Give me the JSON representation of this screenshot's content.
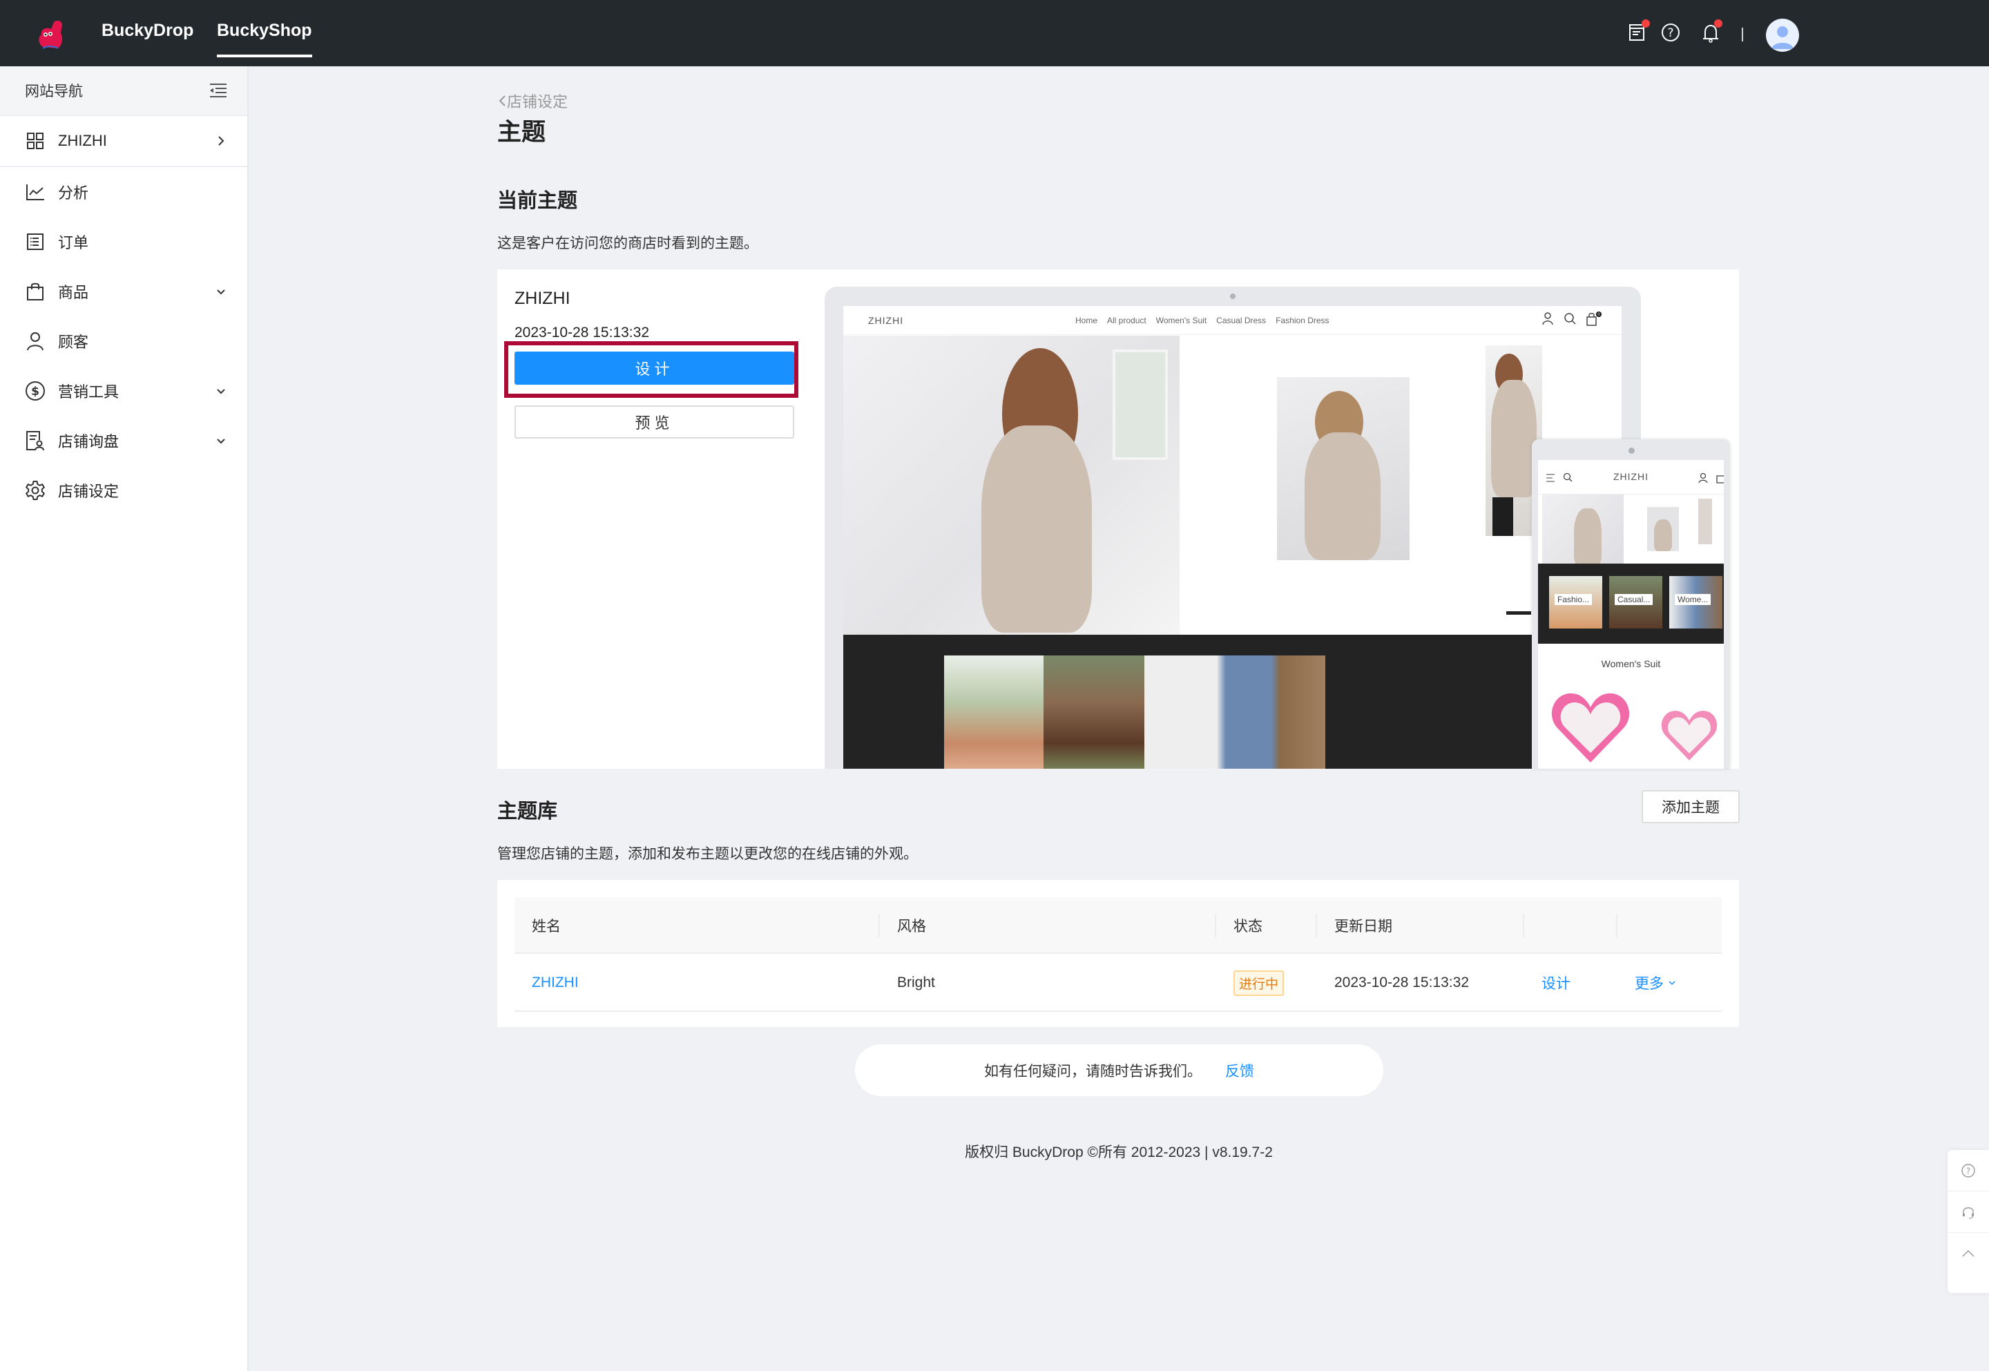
{
  "header": {
    "logo": "buckydrop-mascot-logo",
    "tabs": [
      {
        "label": "BuckyDrop",
        "active": false
      },
      {
        "label": "BuckyShop",
        "active": true
      }
    ],
    "icons": [
      "announcement-icon",
      "help-icon",
      "notification-bell-icon"
    ],
    "avatar": "user-avatar"
  },
  "sidebar": {
    "title": "网站导航",
    "collapse_icon": "menu-collapse-icon",
    "store": {
      "label": "ZHIZHI",
      "icon": "grid-icon",
      "chevron": "chevron-right-icon"
    },
    "items": [
      {
        "label": "分析",
        "icon": "line-chart-icon",
        "expandable": false
      },
      {
        "label": "订单",
        "icon": "order-list-icon",
        "expandable": false
      },
      {
        "label": "商品",
        "icon": "shopping-bag-icon",
        "expandable": true
      },
      {
        "label": "顾客",
        "icon": "user-icon",
        "expandable": false
      },
      {
        "label": "营销工具",
        "icon": "dollar-circle-icon",
        "expandable": true
      },
      {
        "label": "店铺询盘",
        "icon": "inquiry-icon",
        "expandable": true
      },
      {
        "label": "店铺设定",
        "icon": "gear-icon",
        "expandable": false
      }
    ]
  },
  "breadcrumb": {
    "back_label": "店铺设定"
  },
  "page_title": "主题",
  "current_theme": {
    "title": "当前主题",
    "description": "这是客户在访问您的商店时看到的主题。",
    "name": "ZHIZHI",
    "updated": "2023-10-28 15:13:32",
    "design_button": "设计",
    "preview_button": "预览",
    "desktop_preview": {
      "logo": "ZHIZHI",
      "nav_links": [
        "Home",
        "All product",
        "Women's Suit",
        "Casual Dress",
        "Fashion Dress"
      ],
      "cart_count": "0"
    },
    "mobile_preview": {
      "logo": "ZHIZHI",
      "categories": [
        "Fashio...",
        "Casual...",
        "Wome..."
      ],
      "section_title": "Women's Suit"
    }
  },
  "library": {
    "title": "主题库",
    "description": "管理您店铺的主题，添加和发布主题以更改您的在线店铺的外观。",
    "add_button": "添加主题",
    "columns": [
      "姓名",
      "风格",
      "状态",
      "更新日期",
      "",
      ""
    ],
    "rows": [
      {
        "name": "ZHIZHI",
        "style": "Bright",
        "status": "进行中",
        "updated": "2023-10-28 15:13:32",
        "action": "设计",
        "more": "更多"
      }
    ]
  },
  "feedback": {
    "text": "如有任何疑问，请随时告诉我们。",
    "link": "反馈"
  },
  "footer": {
    "copyright": "版权归 BuckyDrop ©所有 2012-2023 | v8.19.7-2"
  },
  "float_widget": [
    "help-icon",
    "customer-service-icon",
    "back-to-top-icon"
  ],
  "colors": {
    "primary": "#1890ff",
    "header_bg": "#24292e",
    "highlight_border": "#ad0b35",
    "status_orange": "#e47b10"
  }
}
